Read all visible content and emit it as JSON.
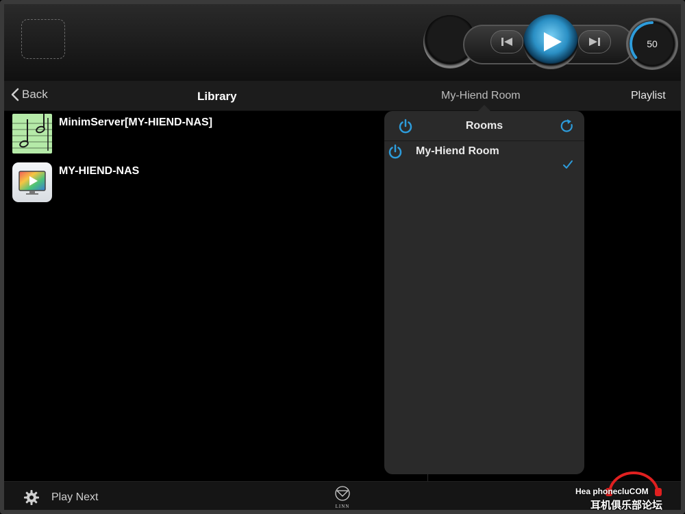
{
  "colors": {
    "accent_blue": "#2d9cdb",
    "nav_bg": "#1c1c1c",
    "popover_bg": "#2a2a2a",
    "music_thumb": "#b5eaa8"
  },
  "transport": {
    "volume": "50",
    "volume_level": 0.5,
    "icons": [
      "skip-previous-icon",
      "play-icon",
      "skip-next-icon"
    ]
  },
  "navbar": {
    "back_label": "Back",
    "title": "Library",
    "room_label": "My-Hiend Room",
    "playlist_label": "Playlist"
  },
  "library": {
    "items": [
      {
        "name": "MinimServer[MY-HIEND-NAS]",
        "icon": "music-note-icon"
      },
      {
        "name": "MY-HIEND-NAS",
        "icon": "media-server-icon"
      }
    ]
  },
  "rooms_popover": {
    "title": "Rooms",
    "rooms": [
      {
        "name": "My-Hiend Room",
        "selected": true
      }
    ]
  },
  "bottombar": {
    "play_next_label": "Play Next",
    "logo_text": "LINN"
  },
  "watermark": {
    "line1": "HeadphoneclubCOM",
    "line1_display": "Hea phonecluCOM",
    "line2": "耳机俱乐部论坛"
  }
}
